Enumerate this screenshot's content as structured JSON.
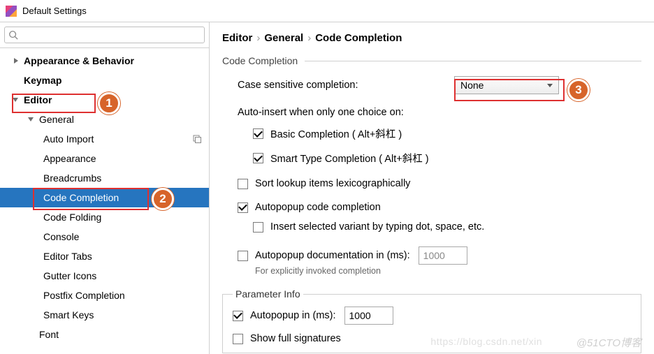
{
  "window": {
    "title": "Default Settings"
  },
  "search": {
    "placeholder": ""
  },
  "tree": {
    "appearance_behavior": "Appearance & Behavior",
    "keymap": "Keymap",
    "editor": "Editor",
    "general": "General",
    "auto_import": "Auto Import",
    "appearance": "Appearance",
    "breadcrumbs": "Breadcrumbs",
    "code_completion": "Code Completion",
    "code_folding": "Code Folding",
    "console": "Console",
    "editor_tabs": "Editor Tabs",
    "gutter_icons": "Gutter Icons",
    "postfix_completion": "Postfix Completion",
    "smart_keys": "Smart Keys",
    "font": "Font"
  },
  "crumbs": {
    "a": "Editor",
    "b": "General",
    "c": "Code Completion",
    "sep": "›"
  },
  "section": {
    "code_completion": "Code Completion",
    "parameter_info": "Parameter Info"
  },
  "labels": {
    "case_sensitive": "Case sensitive completion:",
    "auto_insert": "Auto-insert when only one choice on:",
    "basic": "Basic Completion ( Alt+斜杠 )",
    "smart": "Smart Type Completion ( Alt+斜杠 )",
    "sort": "Sort lookup items lexicographically",
    "autopopup_code": "Autopopup code completion",
    "insert_variant": "Insert selected variant by typing dot, space, etc.",
    "autopopup_doc": "Autopopup documentation in (ms):",
    "autopopup_doc_hint": "For explicitly invoked completion",
    "autopopup_in": "Autopopup in (ms):",
    "show_full": "Show full signatures"
  },
  "values": {
    "case_sensitive": "None",
    "doc_ms": "1000",
    "autopopup_ms": "1000"
  },
  "callouts": {
    "c1": "1",
    "c2": "2",
    "c3": "3"
  },
  "watermark": {
    "a": "https://blog.csdn.net/xin",
    "b": "@51CTO博客"
  }
}
